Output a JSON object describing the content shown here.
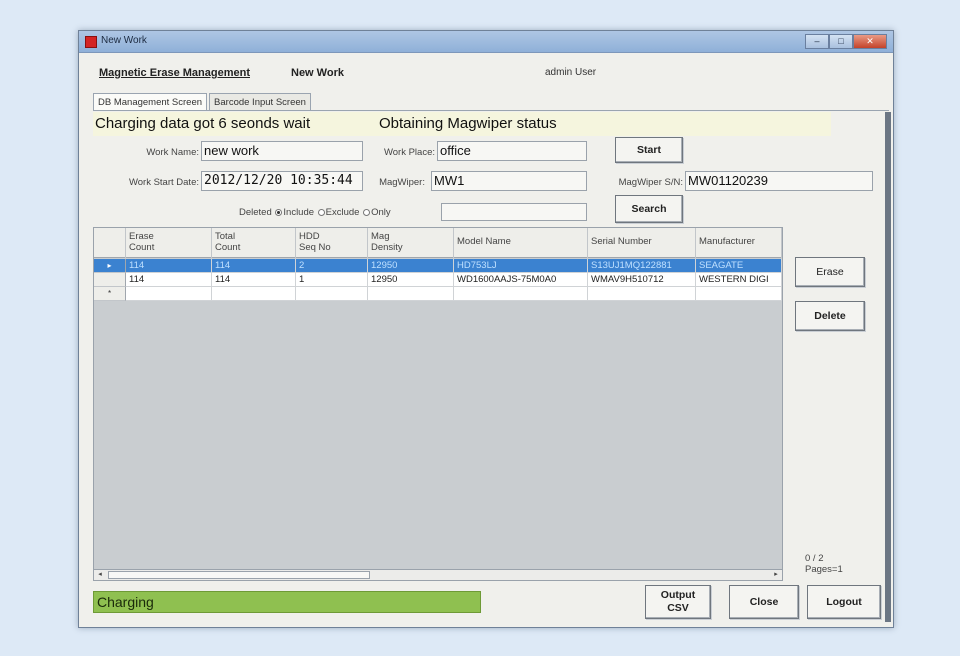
{
  "window": {
    "title": "New Work",
    "controls": {
      "minimize": "–",
      "maximize": "□",
      "close": "✕"
    }
  },
  "menu": {
    "main": "Magnetic Erase Management",
    "new_work": "New Work",
    "user": "admin User"
  },
  "tabs": [
    {
      "label": "DB Management Screen",
      "active": true
    },
    {
      "label": "Barcode Input Screen",
      "active": false
    }
  ],
  "status_banner": {
    "left": "Charging data got 6 seonds wait",
    "right": "Obtaining Magwiper status"
  },
  "form": {
    "work_name_label": "Work Name:",
    "work_name": "new work",
    "work_place_label": "Work Place:",
    "work_place": "office",
    "start_date_label": "Work Start Date:",
    "start_date": "2012/12/20 10:35:44",
    "magwiper_label": "MagWiper:",
    "magwiper": "MW1",
    "serial_label": "MagWiper S/N:",
    "serial": "MW01120239"
  },
  "filter": {
    "label": "Deleted",
    "options": [
      "Include",
      "Exclude",
      "Only"
    ],
    "selected": "Include",
    "value": ""
  },
  "buttons": {
    "start": "Start",
    "search": "Search",
    "erase": "Erase",
    "delete": "Delete",
    "output_csv_line1": "Output",
    "output_csv_line2": "CSV",
    "close": "Close",
    "logout": "Logout"
  },
  "table": {
    "columns": [
      {
        "line1": "Erase",
        "line2": "Count"
      },
      {
        "line1": "Total",
        "line2": "Count"
      },
      {
        "line1": "HDD",
        "line2": "Seq No"
      },
      {
        "line1": "Mag",
        "line2": "Density"
      },
      {
        "line1": "Model Name",
        "line2": ""
      },
      {
        "line1": "Serial Number",
        "line2": ""
      },
      {
        "line1": "Manufacturer",
        "line2": ""
      }
    ],
    "rows": [
      {
        "marker": "▸",
        "selected": true,
        "cells": [
          "114",
          "114",
          "2",
          "12950",
          "HD753LJ",
          "S13UJ1MQ122881",
          "SEAGATE"
        ]
      },
      {
        "marker": "",
        "selected": false,
        "cells": [
          "114",
          "114",
          "1",
          "12950",
          "WD1600AAJS-75M0A0",
          "WMAV9H510712",
          "WESTERN DIGI"
        ]
      },
      {
        "marker": "*",
        "selected": false,
        "cells": [
          "",
          "",
          "",
          "",
          "",
          "",
          ""
        ]
      }
    ]
  },
  "pager": {
    "count": "0 / 2",
    "pages": "Pages=1"
  },
  "statusbar": {
    "text": "Charging"
  },
  "scroll": {
    "left_arrow": "◂",
    "right_arrow": "▸"
  }
}
